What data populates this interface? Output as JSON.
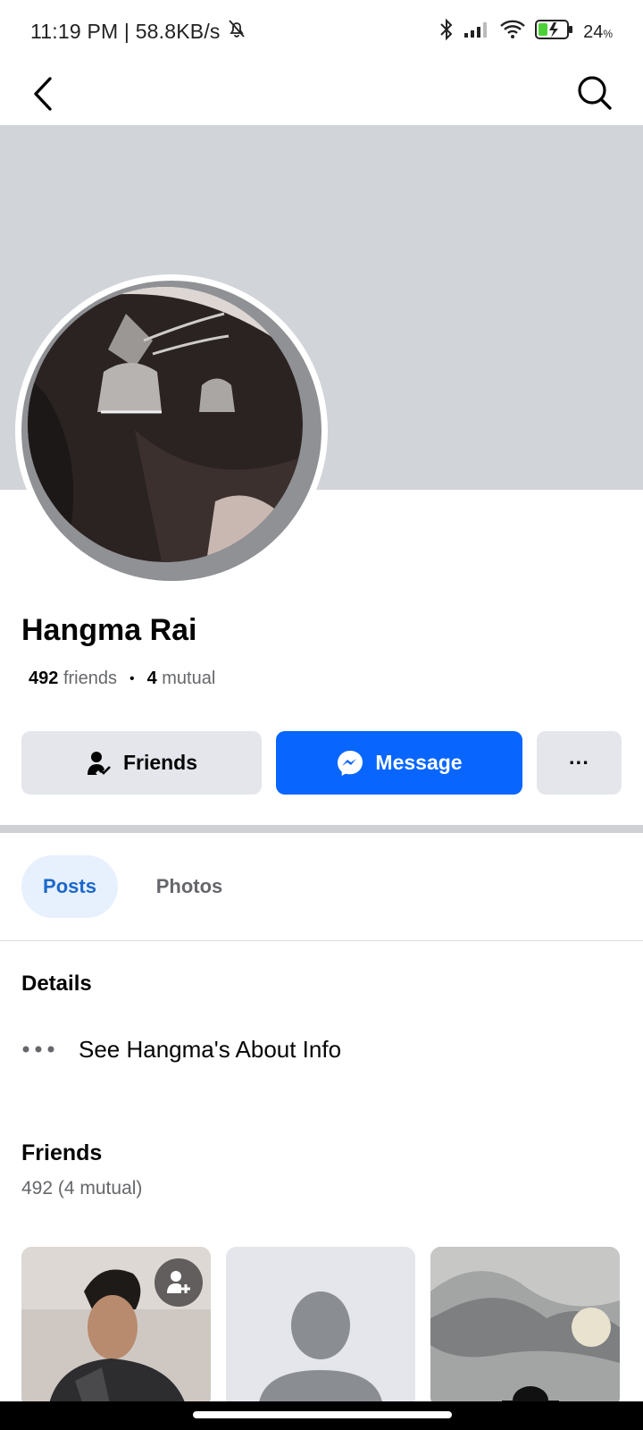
{
  "status_bar": {
    "time_speed": "11:19 PM | 58.8KB/s",
    "battery_percent": "24",
    "battery_unit": "%",
    "icons": [
      "mute-bell-icon",
      "bluetooth-icon",
      "signal-icon",
      "wifi-icon",
      "battery-charging-icon"
    ]
  },
  "nav": {
    "back_icon": "chevron-left-icon",
    "search_icon": "search-icon"
  },
  "profile": {
    "name": "Hangma Rai",
    "friends_count": "492",
    "friends_word": "friends",
    "mutual_count": "4",
    "mutual_word": "mutual"
  },
  "actions": {
    "friends_label": "Friends",
    "message_label": "Message",
    "more_label": "···"
  },
  "tabs": [
    {
      "label": "Posts",
      "active": true
    },
    {
      "label": "Photos",
      "active": false
    }
  ],
  "details": {
    "heading": "Details",
    "about_link": "See Hangma's About Info"
  },
  "friends_section": {
    "heading": "Friends",
    "subtitle": "492 (4 mutual)"
  },
  "colors": {
    "accent": "#0866ff",
    "tab_active_bg": "#e7f0fd",
    "tab_active_text": "#1b68c9",
    "button_gray": "#e4e6eb",
    "cover_gray": "#d1d4d8"
  }
}
